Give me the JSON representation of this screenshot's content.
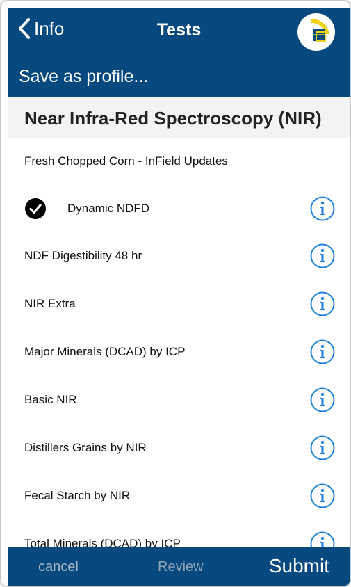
{
  "nav": {
    "back_label": "Info",
    "title": "Tests"
  },
  "save_profile_label": "Save as profile...",
  "section_title": "Near Infra-Red Spectroscopy (NIR)",
  "profile_row": "Fresh Chopped Corn - InField Updates",
  "tests": [
    {
      "label": "Dynamic NDFD",
      "checked": true
    },
    {
      "label": "NDF Digestibility 48 hr",
      "checked": false
    },
    {
      "label": "NIR Extra",
      "checked": false
    },
    {
      "label": "Major Minerals (DCAD) by ICP",
      "checked": false
    },
    {
      "label": "Basic NIR",
      "checked": false
    },
    {
      "label": "Distillers Grains by NIR",
      "checked": false
    },
    {
      "label": "Fecal Starch by NIR",
      "checked": false
    },
    {
      "label": "Total Minerals (DCAD) by ICP",
      "checked": false
    }
  ],
  "toolbar": {
    "cancel_label": "cancel",
    "review_label": "Review",
    "submit_label": "Submit"
  },
  "colors": {
    "brand_blue": "#06497f",
    "info_blue": "#1a7fe0",
    "check_black": "#000000"
  },
  "icons": {
    "back": "chevron-left-icon",
    "logo": "app-logo",
    "info": "info-circle-icon",
    "check": "checkmark-circle-icon"
  }
}
